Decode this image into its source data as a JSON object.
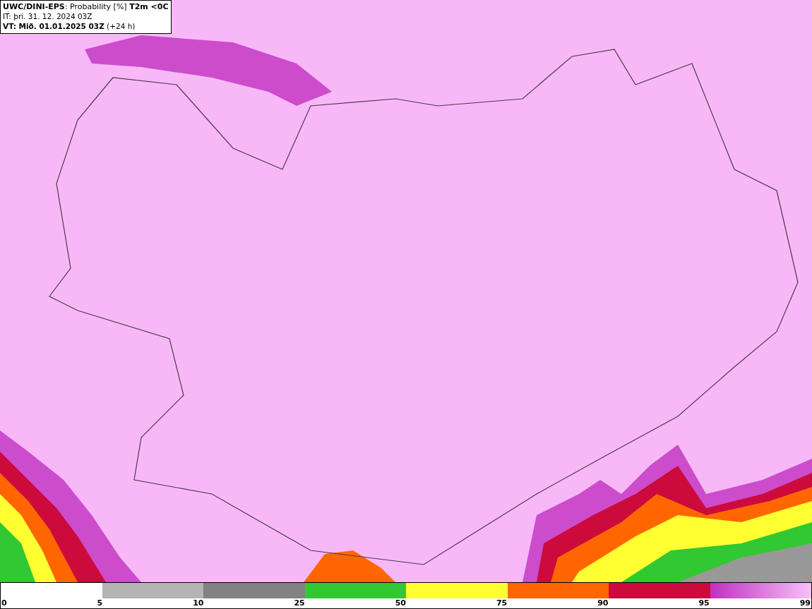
{
  "title_box": {
    "lines": [
      "**UWC/DINI-EPS**: Probability [%] **T2m <0C**",
      "IT: þri. 31. 12. 2024 03Z",
      "**VT: Mið. 01.01.2025 03Z** (+24 h)"
    ]
  },
  "legend": {
    "segments": [
      {
        "kind": "solid",
        "color": "#ffffff"
      },
      {
        "kind": "solid",
        "color": "#b4b4b4"
      },
      {
        "kind": "solid",
        "color": "#828282"
      },
      {
        "kind": "solid",
        "color": "#32c832"
      },
      {
        "kind": "solid",
        "color": "#ffff32"
      },
      {
        "kind": "solid",
        "color": "#ff6600"
      },
      {
        "kind": "solid",
        "color": "#cd0a3c"
      },
      {
        "kind": "gradient"
      }
    ],
    "labels": [
      "0",
      "5",
      "10",
      "25",
      "50",
      "75",
      "90",
      "95",
      "99"
    ]
  }
}
